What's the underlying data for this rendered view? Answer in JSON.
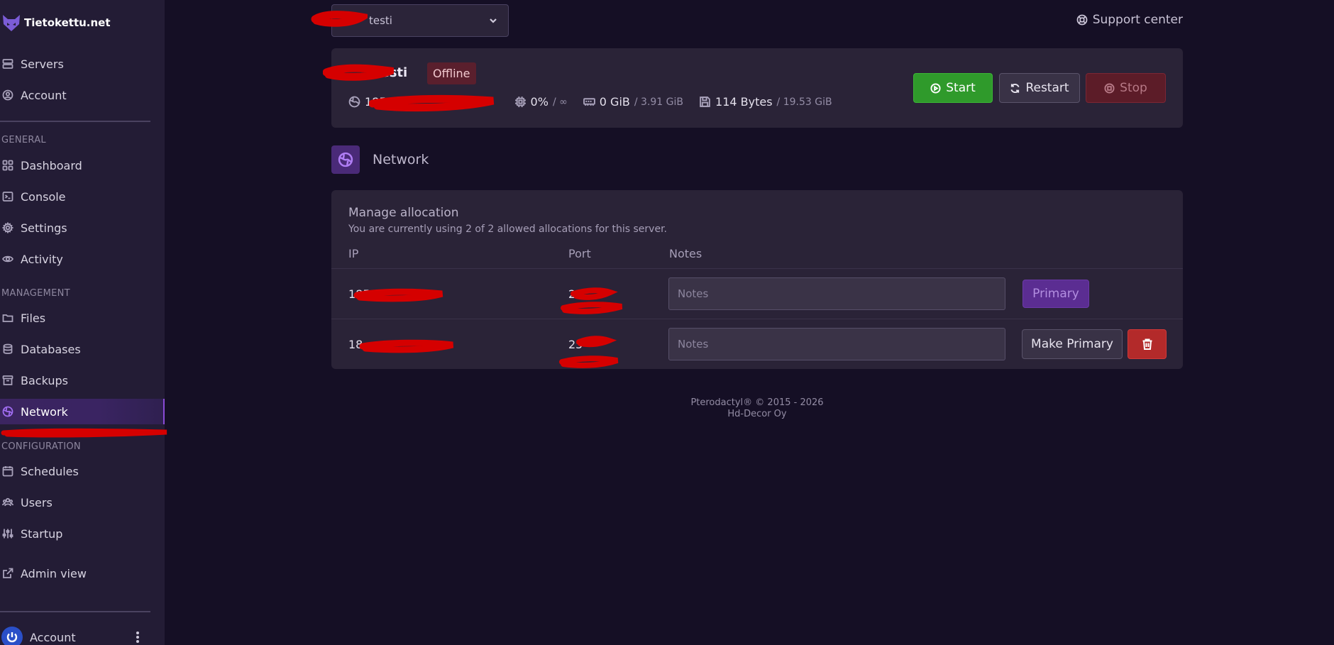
{
  "brand": {
    "name": "Tietokettu.net"
  },
  "sidebar": {
    "top_items": [
      {
        "label": "Servers",
        "icon": "server-icon"
      },
      {
        "label": "Account",
        "icon": "user-circle-icon"
      }
    ],
    "sections": {
      "general": "GENERAL",
      "management": "MANAGEMENT",
      "configuration": "CONFIGURATION"
    },
    "general_items": [
      {
        "label": "Dashboard",
        "icon": "grid-icon"
      },
      {
        "label": "Console",
        "icon": "terminal-icon"
      },
      {
        "label": "Settings",
        "icon": "gear-icon"
      },
      {
        "label": "Activity",
        "icon": "eye-icon"
      }
    ],
    "management_items": [
      {
        "label": "Files",
        "icon": "folder-icon"
      },
      {
        "label": "Databases",
        "icon": "database-icon"
      },
      {
        "label": "Backups",
        "icon": "archive-icon"
      },
      {
        "label": "Network",
        "icon": "globe-icon",
        "active": true
      }
    ],
    "configuration_items": [
      {
        "label": "Schedules",
        "icon": "calendar-icon"
      },
      {
        "label": "Users",
        "icon": "users-icon"
      },
      {
        "label": "Startup",
        "icon": "sliders-icon"
      }
    ],
    "admin_view": "Admin view",
    "footer_account": "Account"
  },
  "server_select": {
    "value": "testi"
  },
  "support": {
    "label": "Support center"
  },
  "server": {
    "name": "kesti",
    "status": "Offline",
    "ip_prefix": "185",
    "cpu": "0%",
    "cpu_limit": "/ ∞",
    "memory": "0 GiB",
    "memory_limit": "/ 3.91 GiB",
    "disk": "114 Bytes",
    "disk_limit": "/ 19.53 GiB"
  },
  "controls": {
    "start": "Start",
    "restart": "Restart",
    "stop": "Stop"
  },
  "page": {
    "title": "Network"
  },
  "allocation": {
    "title": "Manage allocation",
    "subtitle": "You are currently using 2 of 2 allowed allocations for this server.",
    "headers": {
      "ip": "IP",
      "port": "Port",
      "notes": "Notes"
    },
    "notes_placeholder": "Notes",
    "rows": [
      {
        "ip": "185",
        "port": "25",
        "action": "Primary"
      },
      {
        "ip": "18",
        "port": "25",
        "action": "Make Primary"
      }
    ]
  },
  "footer": {
    "line1": "Pterodactyl® © 2015 - 2026",
    "line2": "Hd-Decor Oy"
  },
  "colors": {
    "accent": "#8a4bd6",
    "start": "#2f9a2b",
    "danger": "#b32a2a",
    "offline_badge": "#5a1f2d"
  }
}
